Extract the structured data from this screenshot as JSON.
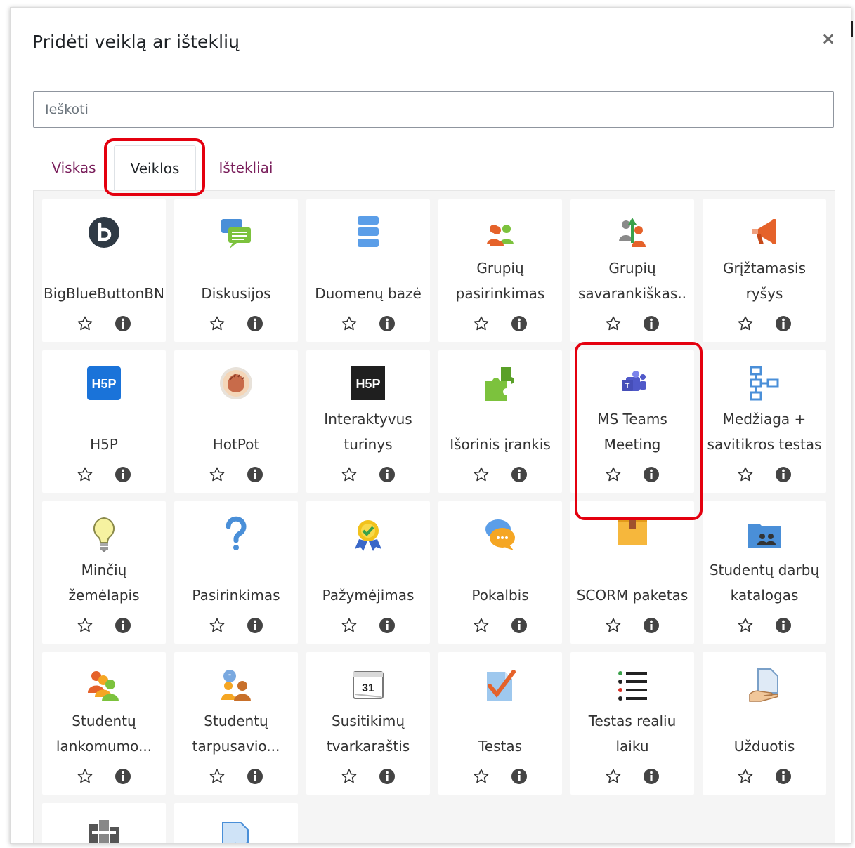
{
  "dialog": {
    "title": "Pridėti veiklą ar išteklių",
    "close_label": "×",
    "search_placeholder": "Ieškoti"
  },
  "tabs": [
    {
      "label": "Viskas"
    },
    {
      "label": "Veiklos"
    },
    {
      "label": "Ištekliai"
    }
  ],
  "colors": {
    "link": "#7a1f5c",
    "highlight": "#e4000f",
    "info_icon": "#444444"
  },
  "items": [
    {
      "label": "BigBlueButtonBN",
      "icon": "bigbluebutton-icon"
    },
    {
      "label": "Diskusijos",
      "icon": "forum-icon"
    },
    {
      "label": "Duomenų bazė",
      "icon": "database-icon"
    },
    {
      "label": "Grupių pasirinkimas",
      "icon": "group-choice-icon"
    },
    {
      "label": "Grupių savarankiškas..",
      "icon": "group-self-selection-icon"
    },
    {
      "label": "Grįžtamasis ryšys",
      "icon": "feedback-megaphone-icon"
    },
    {
      "label": "H5P",
      "icon": "h5p-icon"
    },
    {
      "label": "HotPot",
      "icon": "hotpot-icon"
    },
    {
      "label": "Interaktyvus turinys",
      "icon": "h5p-dark-icon"
    },
    {
      "label": "Išorinis įrankis",
      "icon": "puzzle-icon"
    },
    {
      "label": "MS Teams Meeting",
      "icon": "teams-icon"
    },
    {
      "label": "Medžiaga + savitikros testas",
      "icon": "lesson-flowchart-icon"
    },
    {
      "label": "Minčių žemėlapis",
      "icon": "lightbulb-icon"
    },
    {
      "label": "Pasirinkimas",
      "icon": "question-icon"
    },
    {
      "label": "Pažymėjimas",
      "icon": "certificate-icon"
    },
    {
      "label": "Pokalbis",
      "icon": "chat-icon"
    },
    {
      "label": "SCORM paketas",
      "icon": "scorm-box-icon"
    },
    {
      "label": "Studentų darbų katalogas",
      "icon": "folder-users-icon"
    },
    {
      "label": "Studentų lankomumo...",
      "icon": "attendance-icon"
    },
    {
      "label": "Studentų tarpusavio...",
      "icon": "workshop-icon"
    },
    {
      "label": "Susitikimų tvarkaraštis",
      "icon": "calendar-icon",
      "calendar_day": "31"
    },
    {
      "label": "Testas",
      "icon": "quiz-check-icon"
    },
    {
      "label": "Testas realiu laiku",
      "icon": "list-icon"
    },
    {
      "label": "Užduotis",
      "icon": "assignment-icon"
    },
    {
      "label": "",
      "icon": "partial-icon-a"
    },
    {
      "label": "",
      "icon": "partial-icon-b"
    }
  ]
}
